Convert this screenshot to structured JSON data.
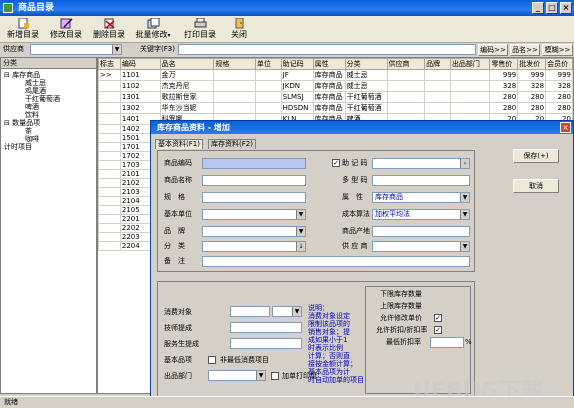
{
  "window": {
    "title": "商品目录"
  },
  "toolbar": {
    "items": [
      "新增目录",
      "修改目录",
      "删除目录",
      "批量修改",
      "打印目录",
      "关闭"
    ]
  },
  "search": {
    "supplier_label": "供应商",
    "keyword_label": "关键字(F3)",
    "btn_code": "编码>>",
    "btn_name": "品名>>",
    "btn_fuzzy": "模糊>>"
  },
  "sidebar": {
    "header": "分类",
    "tree": [
      "库存商品",
      "威士忌",
      "鸡尾酒",
      "干红葡萄酒",
      "啤酒",
      "饮料",
      "数量品项",
      "茶",
      "咖啡",
      "计时项目"
    ]
  },
  "grid": {
    "columns": [
      "标志",
      "编码",
      "品名",
      "规格",
      "单位",
      "助记码",
      "属性",
      "分类",
      "供应商",
      "品牌",
      "出品部门",
      "零售价",
      "批发价",
      "会员价"
    ],
    "rows": [
      [
        "",
        "1101",
        "金万",
        "",
        "",
        "JF",
        "库存商品",
        "威士忌",
        "",
        "",
        "",
        "999",
        "999",
        "999"
      ],
      [
        "",
        "1102",
        "杰克丹尼",
        "",
        "",
        "JKDN",
        "库存商品",
        "威士忌",
        "",
        "",
        "",
        "328",
        "328",
        "328"
      ],
      [
        "",
        "1301",
        "歌拉斯世家",
        "",
        "",
        "SLMSJ",
        "库存商品",
        "干红葡萄酒",
        "",
        "",
        "",
        "280",
        "280",
        "280"
      ],
      [
        "",
        "1302",
        "华东沙当妮",
        "",
        "",
        "HDSDN",
        "库存商品",
        "干红葡萄酒",
        "",
        "",
        "",
        "280",
        "280",
        "280"
      ],
      [
        "",
        "1401",
        "科罗娜",
        "",
        "",
        "KLN",
        "库存商品",
        "啤酒",
        "",
        "",
        "",
        "20",
        "20",
        "20"
      ],
      [
        "",
        "1402",
        "",
        "",
        "",
        "",
        "",
        "",
        "",
        "",
        "",
        "",
        "",
        ""
      ],
      [
        "",
        "1501",
        "",
        "",
        "",
        "",
        "",
        "",
        "",
        "",
        "",
        "",
        "",
        ""
      ],
      [
        "",
        "1701",
        "",
        "",
        "",
        "",
        "",
        "",
        "",
        "",
        "",
        "",
        "",
        ""
      ],
      [
        "",
        "1702",
        "",
        "",
        "",
        "",
        "",
        "",
        "",
        "",
        "",
        "",
        "",
        ""
      ],
      [
        "",
        "1703",
        "",
        "",
        "",
        "",
        "",
        "",
        "",
        "",
        "",
        "",
        "",
        ""
      ],
      [
        "",
        "2101",
        "",
        "",
        "",
        "",
        "",
        "",
        "",
        "",
        "",
        "",
        "",
        ""
      ],
      [
        "",
        "2102",
        "",
        "",
        "",
        "",
        "",
        "",
        "",
        "",
        "",
        "",
        "",
        ""
      ],
      [
        "",
        "2103",
        "",
        "",
        "",
        "",
        "",
        "",
        "",
        "",
        "",
        "",
        "",
        ""
      ],
      [
        "",
        "2104",
        "",
        "",
        "",
        "",
        "",
        "",
        "",
        "",
        "",
        "",
        "",
        ""
      ],
      [
        "",
        "2105",
        "",
        "",
        "",
        "",
        "",
        "",
        "",
        "",
        "",
        "",
        "",
        ""
      ],
      [
        "",
        "2201",
        "",
        "",
        "",
        "",
        "",
        "",
        "",
        "",
        "",
        "",
        "",
        ""
      ],
      [
        "",
        "2202",
        "",
        "",
        "",
        "",
        "",
        "",
        "",
        "",
        "",
        "",
        "",
        ""
      ],
      [
        "",
        "2203",
        "",
        "",
        "",
        "",
        "",
        "",
        "",
        "",
        "",
        "",
        "",
        ""
      ],
      [
        "",
        "2204",
        "",
        "",
        "",
        "",
        "",
        "",
        "",
        "",
        "",
        "",
        "",
        ""
      ]
    ],
    "row_marker": ">>"
  },
  "dialog": {
    "title": "库存商品资料 - 增加",
    "tabs": [
      "基本资料(F1)",
      "库存资料(F2)"
    ],
    "left_labels": [
      "商品编码",
      "商品名称",
      "规　格",
      "基本单位",
      "品　牌",
      "分　类",
      "备　注"
    ],
    "right_labels": [
      "助 记 码",
      "多 型 码",
      "属　性",
      "成本算法",
      "商品产地",
      "供 应 商"
    ],
    "attr_value": "库存商品",
    "cost_value": "加权平均法",
    "consume_labels": [
      "消费对象",
      "技师提成",
      "服务生提成",
      "基本品项",
      "出品部门"
    ],
    "checkbox_min": "非最低消费项目",
    "checkbox_print": "加单打印厨",
    "note": "说明：\n消费对象设定\n限制该品项的\n销售对象；提\n成如果小于1\n时表示比例\n计算；否则直\n接按金额计算；\n基本品项为计\n时自动加单的项目",
    "stock_labels": [
      "下限库存数量",
      "上限库存数量",
      "允许修改单价",
      "允许折扣/折扣率",
      "最低折扣率"
    ],
    "pct": "%",
    "save_btn": "保存(+)",
    "cancel_btn": "取消"
  },
  "status": {
    "text": "就绪"
  },
  "watermark": "UEBUG下载"
}
